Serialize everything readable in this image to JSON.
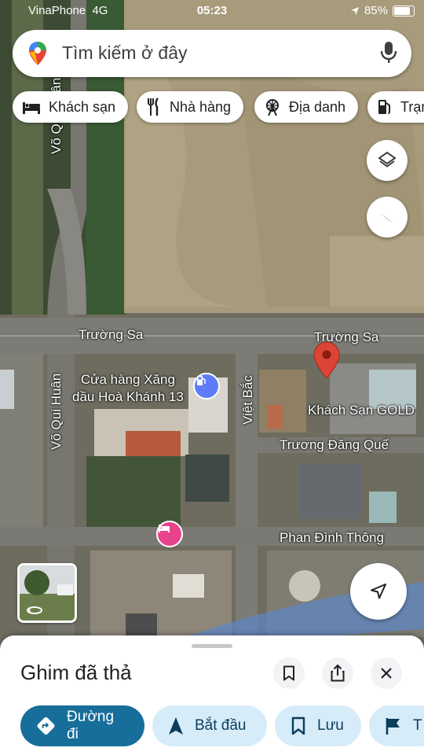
{
  "status_bar": {
    "carrier": "VinaPhone",
    "network": "4G",
    "time": "05:23",
    "battery": "85%"
  },
  "search": {
    "placeholder": "Tìm kiếm ở đây",
    "icons": [
      "maps-pin-icon",
      "mic-icon"
    ]
  },
  "chips": [
    {
      "label": "Khách sạn",
      "icon": "bed-icon"
    },
    {
      "label": "Nhà hàng",
      "icon": "fork-knife-icon"
    },
    {
      "label": "Địa danh",
      "icon": "ferris-wheel-icon"
    },
    {
      "label": "Trạm",
      "icon": "gas-pump-icon"
    }
  ],
  "map": {
    "streets": [
      "Võ Qui Huân",
      "Trường Sa",
      "Trường Sa",
      "Việt Bắc",
      "Võ Qui Huân",
      "Trương Đăng Quế",
      "Phan Đình Thông"
    ],
    "pois": [
      "Cửa hàng Xăng\ndầu Hoà Khánh 13",
      "Khách Sạn GOLD"
    ],
    "dropped_pin_color": "#db4437",
    "poi_gas_color": "#5e7cf7",
    "poi_hotel_color": "#e8438b"
  },
  "sheet": {
    "title": "Ghim đã thả",
    "actions": [
      {
        "label": "Đường đi",
        "icon": "directions-icon"
      },
      {
        "label": "Bắt đầu",
        "icon": "navigation-arrow-icon"
      },
      {
        "label": "Lưu",
        "icon": "bookmark-icon"
      },
      {
        "label": "T",
        "icon": "flag-icon"
      }
    ]
  },
  "colors": {
    "primary_button": "#176e9a",
    "secondary_button": "#d7ecf9"
  }
}
